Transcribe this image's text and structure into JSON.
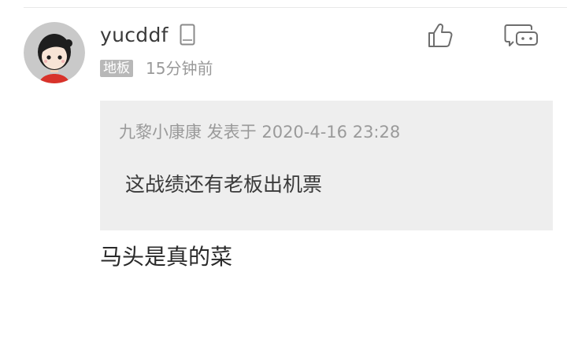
{
  "comment": {
    "username": "yucddf",
    "floor_label": "地板",
    "time_ago": "15分钟前",
    "content": "马头是真的菜"
  },
  "quote": {
    "meta": "九黎小康康 发表于 2020-4-16 23:28",
    "text": "这战绩还有老板出机票"
  },
  "icons": {
    "device": "phone-icon",
    "like": "thumbs-up-icon",
    "reply": "comment-bubble-icon"
  },
  "colors": {
    "badge_bg": "#b8b8b8",
    "quote_bg": "#eeeeee",
    "muted_text": "#9a9a9a",
    "main_text": "#2a2a2a"
  }
}
